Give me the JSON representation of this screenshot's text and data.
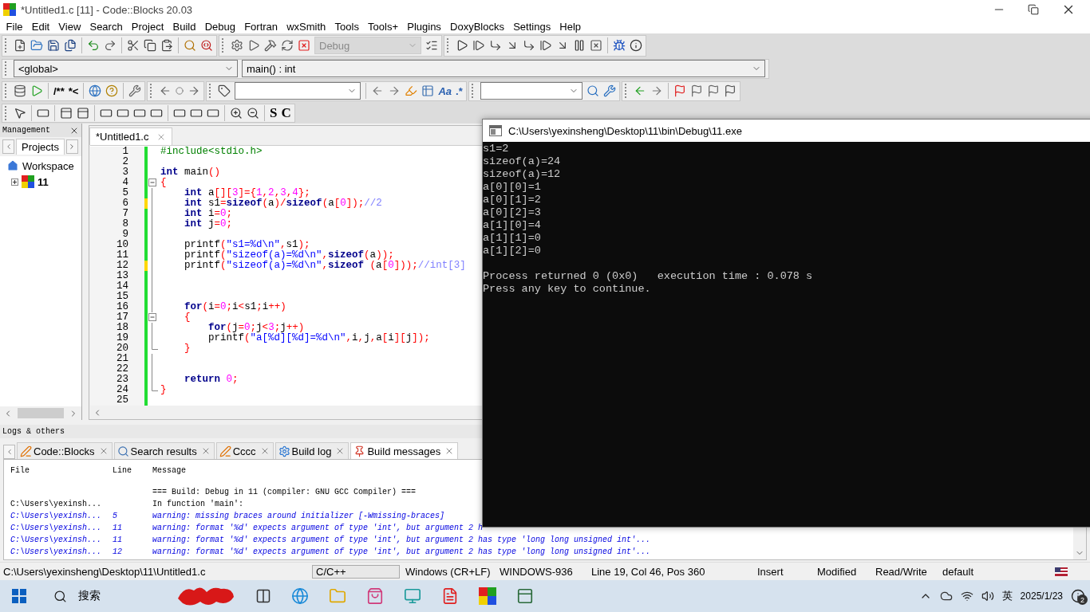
{
  "window": {
    "title": "*Untitled1.c [11] - Code::Blocks 20.03"
  },
  "menu": [
    "File",
    "Edit",
    "View",
    "Search",
    "Project",
    "Build",
    "Debug",
    "Fortran",
    "wxSmith",
    "Tools",
    "Tools+",
    "Plugins",
    "DoxyBlocks",
    "Settings",
    "Help"
  ],
  "build_target": {
    "value": "Debug",
    "disabled": true
  },
  "scope": {
    "value": "<global>"
  },
  "function": {
    "value": "main() : int"
  },
  "toolbar_glyphs": {
    "doc_comment": "/**",
    "line_comment": "*<",
    "match_case": "Aa",
    "regex": ".*",
    "glyph_s": "S",
    "glyph_c": "C"
  },
  "management": {
    "title": "Management",
    "tabs": [
      {
        "label": "Projects",
        "selected": true
      }
    ],
    "tree": [
      {
        "label": "Workspace",
        "children": [
          {
            "label": "11",
            "expanded": false
          }
        ]
      }
    ]
  },
  "editor": {
    "tabs": [
      {
        "label": "*Untitled1.c",
        "selected": true
      }
    ],
    "lines": [
      {
        "n": "1",
        "modified": false,
        "kind": "plain",
        "tokens": [
          {
            "kind": "preprocessor",
            "text": "#include<stdio.h>"
          }
        ]
      },
      {
        "n": "2",
        "modified": false,
        "kind": "plain"
      },
      {
        "n": "3",
        "modified": false,
        "kind": "plain",
        "tokens": [
          {
            "kind": "keyword",
            "text": "int"
          },
          {
            "kind": "identifier",
            "text": " main"
          },
          {
            "kind": "operator",
            "text": "()"
          }
        ]
      },
      {
        "n": "4",
        "modified": false,
        "kind": "fold_start",
        "tokens": [
          {
            "kind": "operator",
            "text": "{"
          }
        ]
      },
      {
        "n": "5",
        "modified": false,
        "kind": "fold_line",
        "tokens": [
          {
            "kind": "keyword",
            "text": "    int"
          },
          {
            "kind": "identifier",
            "text": " a"
          },
          {
            "kind": "operator",
            "text": "[]["
          },
          {
            "kind": "number",
            "text": "3"
          },
          {
            "kind": "operator",
            "text": "]={"
          },
          {
            "kind": "number",
            "text": "1"
          },
          {
            "kind": "operator",
            "text": ","
          },
          {
            "kind": "number",
            "text": "2"
          },
          {
            "kind": "operator",
            "text": ","
          },
          {
            "kind": "number",
            "text": "3"
          },
          {
            "kind": "operator",
            "text": ","
          },
          {
            "kind": "number",
            "text": "4"
          },
          {
            "kind": "operator",
            "text": "};"
          }
        ]
      },
      {
        "n": "6",
        "modified": true,
        "kind": "fold_line",
        "tokens": [
          {
            "kind": "keyword",
            "text": "    int"
          },
          {
            "kind": "identifier",
            "text": " s1"
          },
          {
            "kind": "operator",
            "text": "="
          },
          {
            "kind": "keyword",
            "text": "sizeof"
          },
          {
            "kind": "operator",
            "text": "("
          },
          {
            "kind": "identifier",
            "text": "a"
          },
          {
            "kind": "operator",
            "text": ")/"
          },
          {
            "kind": "keyword",
            "text": "sizeof"
          },
          {
            "kind": "operator",
            "text": "("
          },
          {
            "kind": "identifier",
            "text": "a"
          },
          {
            "kind": "operator",
            "text": "["
          },
          {
            "kind": "number",
            "text": "0"
          },
          {
            "kind": "operator",
            "text": "]);"
          },
          {
            "kind": "comment",
            "text": "//2"
          }
        ]
      },
      {
        "n": "7",
        "modified": false,
        "kind": "fold_line",
        "tokens": [
          {
            "kind": "keyword",
            "text": "    int"
          },
          {
            "kind": "identifier",
            "text": " i"
          },
          {
            "kind": "operator",
            "text": "="
          },
          {
            "kind": "number",
            "text": "0"
          },
          {
            "kind": "operator",
            "text": ";"
          }
        ]
      },
      {
        "n": "8",
        "modified": false,
        "kind": "fold_line",
        "tokens": [
          {
            "kind": "keyword",
            "text": "    int"
          },
          {
            "kind": "identifier",
            "text": " j"
          },
          {
            "kind": "operator",
            "text": "="
          },
          {
            "kind": "number",
            "text": "0"
          },
          {
            "kind": "operator",
            "text": ";"
          }
        ]
      },
      {
        "n": "9",
        "modified": false,
        "kind": "fold_line"
      },
      {
        "n": "10",
        "modified": false,
        "kind": "fold_line",
        "tokens": [
          {
            "kind": "identifier",
            "text": "    printf"
          },
          {
            "kind": "operator",
            "text": "("
          },
          {
            "kind": "string",
            "text": "\"s1=%d\\n\""
          },
          {
            "kind": "operator",
            "text": ","
          },
          {
            "kind": "identifier",
            "text": "s1"
          },
          {
            "kind": "operator",
            "text": ");"
          }
        ]
      },
      {
        "n": "11",
        "modified": false,
        "kind": "fold_line",
        "tokens": [
          {
            "kind": "identifier",
            "text": "    printf"
          },
          {
            "kind": "operator",
            "text": "("
          },
          {
            "kind": "string",
            "text": "\"sizeof(a)=%d\\n\""
          },
          {
            "kind": "operator",
            "text": ","
          },
          {
            "kind": "keyword",
            "text": "sizeof"
          },
          {
            "kind": "operator",
            "text": "("
          },
          {
            "kind": "identifier",
            "text": "a"
          },
          {
            "kind": "operator",
            "text": "));"
          }
        ]
      },
      {
        "n": "12",
        "modified": true,
        "kind": "fold_line",
        "tokens": [
          {
            "kind": "identifier",
            "text": "    printf"
          },
          {
            "kind": "operator",
            "text": "("
          },
          {
            "kind": "string",
            "text": "\"sizeof(a)=%d\\n\""
          },
          {
            "kind": "operator",
            "text": ","
          },
          {
            "kind": "keyword",
            "text": "sizeof"
          },
          {
            "kind": "operator",
            "text": " ("
          },
          {
            "kind": "identifier",
            "text": "a"
          },
          {
            "kind": "operator",
            "text": "["
          },
          {
            "kind": "number",
            "text": "0"
          },
          {
            "kind": "operator",
            "text": "]));"
          },
          {
            "kind": "comment",
            "text": "//int[3]"
          }
        ]
      },
      {
        "n": "13",
        "modified": false,
        "kind": "fold_line"
      },
      {
        "n": "14",
        "modified": false,
        "kind": "fold_line"
      },
      {
        "n": "15",
        "modified": false,
        "kind": "fold_line"
      },
      {
        "n": "16",
        "modified": false,
        "kind": "fold_line",
        "tokens": [
          {
            "kind": "keyword",
            "text": "    for"
          },
          {
            "kind": "operator",
            "text": "("
          },
          {
            "kind": "identifier",
            "text": "i"
          },
          {
            "kind": "operator",
            "text": "="
          },
          {
            "kind": "number",
            "text": "0"
          },
          {
            "kind": "operator",
            "text": ";"
          },
          {
            "kind": "identifier",
            "text": "i"
          },
          {
            "kind": "operator",
            "text": "<"
          },
          {
            "kind": "identifier",
            "text": "s1"
          },
          {
            "kind": "operator",
            "text": ";"
          },
          {
            "kind": "identifier",
            "text": "i"
          },
          {
            "kind": "operator",
            "text": "++)"
          }
        ]
      },
      {
        "n": "17",
        "modified": false,
        "kind": "fold_start",
        "tokens": [
          {
            "kind": "operator",
            "text": "    {"
          }
        ]
      },
      {
        "n": "18",
        "modified": false,
        "kind": "fold_line",
        "tokens": [
          {
            "kind": "keyword",
            "text": "        for"
          },
          {
            "kind": "operator",
            "text": "("
          },
          {
            "kind": "identifier",
            "text": "j"
          },
          {
            "kind": "operator",
            "text": "="
          },
          {
            "kind": "number",
            "text": "0"
          },
          {
            "kind": "operator",
            "text": ";"
          },
          {
            "kind": "identifier",
            "text": "j"
          },
          {
            "kind": "operator",
            "text": "<"
          },
          {
            "kind": "number",
            "text": "3"
          },
          {
            "kind": "operator",
            "text": ";"
          },
          {
            "kind": "identifier",
            "text": "j"
          },
          {
            "kind": "operator",
            "text": "++)"
          }
        ]
      },
      {
        "n": "19",
        "modified": false,
        "kind": "fold_line",
        "tokens": [
          {
            "kind": "identifier",
            "text": "        printf"
          },
          {
            "kind": "operator",
            "text": "("
          },
          {
            "kind": "string",
            "text": "\"a[%d][%d]=%d\\n\""
          },
          {
            "kind": "operator",
            "text": ","
          },
          {
            "kind": "identifier",
            "text": "i"
          },
          {
            "kind": "operator",
            "text": ","
          },
          {
            "kind": "identifier",
            "text": "j"
          },
          {
            "kind": "operator",
            "text": ","
          },
          {
            "kind": "identifier",
            "text": "a"
          },
          {
            "kind": "operator",
            "text": "["
          },
          {
            "kind": "identifier",
            "text": "i"
          },
          {
            "kind": "operator",
            "text": "]["
          },
          {
            "kind": "identifier",
            "text": "j"
          },
          {
            "kind": "operator",
            "text": "]);"
          }
        ]
      },
      {
        "n": "20",
        "modified": false,
        "kind": "fold_end",
        "tokens": [
          {
            "kind": "operator",
            "text": "    }"
          }
        ]
      },
      {
        "n": "21",
        "modified": false,
        "kind": "fold_line"
      },
      {
        "n": "22",
        "modified": false,
        "kind": "fold_line"
      },
      {
        "n": "23",
        "modified": false,
        "kind": "fold_line",
        "tokens": [
          {
            "kind": "keyword",
            "text": "    return"
          },
          {
            "kind": "number",
            "text": " 0"
          },
          {
            "kind": "operator",
            "text": ";"
          }
        ]
      },
      {
        "n": "24",
        "modified": false,
        "kind": "fold_end",
        "tokens": [
          {
            "kind": "operator",
            "text": "}"
          }
        ]
      },
      {
        "n": "25",
        "modified": false,
        "kind": "plain"
      }
    ]
  },
  "logs": {
    "title": "Logs & others",
    "tabs": [
      {
        "label": "Code::Blocks",
        "selected": false
      },
      {
        "label": "Search results",
        "selected": false
      },
      {
        "label": "Cccc",
        "selected": false
      },
      {
        "label": "Build log",
        "selected": false
      },
      {
        "label": "Build messages",
        "selected": true
      }
    ],
    "columns": [
      "File",
      "Line",
      "Message"
    ],
    "rows": [
      {
        "kind": "info",
        "message": "=== Build: Debug in 11 (compiler: GNU GCC Compiler) ==="
      },
      {
        "kind": "info",
        "file": "C:\\Users\\yexinsh...",
        "message": "In function 'main':"
      },
      {
        "kind": "warning",
        "file": "C:\\Users\\yexinsh...",
        "line": "5",
        "message": "warning: missing braces around initializer [-Wmissing-braces]"
      },
      {
        "kind": "warning",
        "file": "C:\\Users\\yexinsh...",
        "line": "11",
        "message": "warning: format '%d' expects argument of type 'int', but argument 2 h"
      },
      {
        "kind": "warning",
        "file": "C:\\Users\\yexinsh...",
        "line": "11",
        "message": "warning: format '%d' expects argument of type 'int', but argument 2 has type 'long long unsigned int'..."
      },
      {
        "kind": "warning",
        "file": "C:\\Users\\yexinsh...",
        "line": "12",
        "message": "warning: format '%d' expects argument of type 'int', but argument 2 has type 'long long unsigned int'..."
      }
    ]
  },
  "status_bar": [
    "C:\\Users\\yexinsheng\\Desktop\\11\\Untitled1.c",
    "C/C++",
    "Windows (CR+LF)",
    "WINDOWS-936",
    "Line 19, Col 46, Pos 360",
    "Insert",
    "Modified",
    "Read/Write",
    "default"
  ],
  "console": {
    "title": "C:\\Users\\yexinsheng\\Desktop\\11\\bin\\Debug\\11.exe",
    "output": [
      "s1=2",
      "sizeof(a)=24",
      "sizeof(a)=12",
      "a[0][0]=1",
      "a[0][1]=2",
      "a[0][2]=3",
      "a[1][0]=4",
      "a[1][1]=0",
      "a[1][2]=0"
    ],
    "footer": [
      "Process returned 0 (0x0)   execution time : 0.078 s",
      "Press any key to continue."
    ]
  },
  "taskbar": {
    "search": "搜索",
    "input_language": "英",
    "date": "2025/1/23",
    "notifications": "2"
  }
}
